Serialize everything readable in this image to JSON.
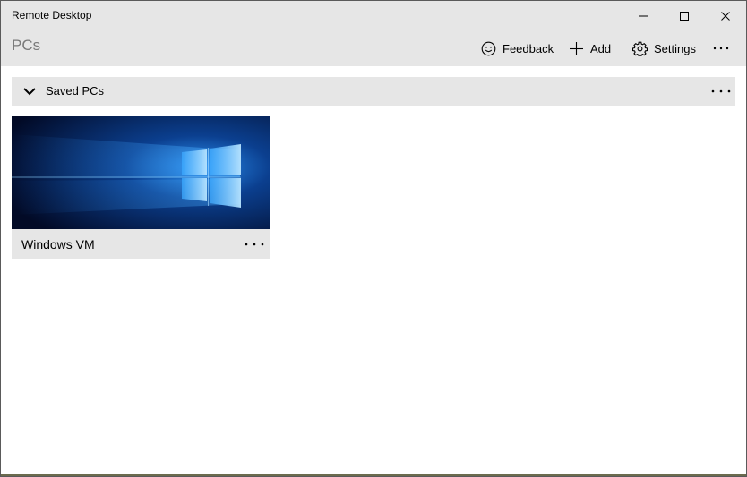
{
  "window": {
    "title": "Remote Desktop"
  },
  "header": {
    "page_title": "PCs",
    "feedback_label": "Feedback",
    "add_label": "Add",
    "settings_label": "Settings"
  },
  "saved_group": {
    "label": "Saved PCs"
  },
  "tiles": [
    {
      "name": "Windows VM"
    }
  ],
  "icons": {
    "minimize": "minimize-icon",
    "maximize": "maximize-icon",
    "close": "close-icon",
    "feedback": "smiley-icon",
    "add": "plus-icon",
    "settings": "gear-icon",
    "more": "ellipsis-icon",
    "chevron": "chevron-down-icon"
  },
  "colors": {
    "chrome": "#e6e6e6",
    "page_title": "#7a7a7a",
    "thumb_accent": "#1a8fe8"
  }
}
